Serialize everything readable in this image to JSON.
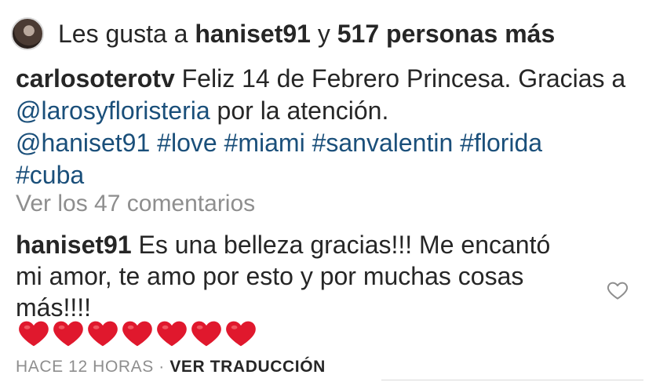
{
  "likes": {
    "prefix": "Les gusta a ",
    "user": "haniset91",
    "conjunction": " y ",
    "others": "517 personas más"
  },
  "caption": {
    "author": "carlosoterotv",
    "text_part1": " Feliz 14 de Febrero Princesa. Gracias a ",
    "mention1": "@larosyfloristeria",
    "text_part2": " por la atención.",
    "mention2": "@haniset91",
    "hashtags": [
      "#love",
      "#miami",
      "#sanvalentin",
      "#florida",
      "#cuba"
    ]
  },
  "view_comments": "Ver los 47 comentarios",
  "comment": {
    "author": "haniset91",
    "text": " Es una belleza gracias!!! Me encantó mi amor, te amo por esto y por muchas cosas más!!!!",
    "emoji": "❤❤❤❤❤❤❤",
    "emoji_count": 7,
    "like_icon": "heart-outline-icon"
  },
  "meta": {
    "timestamp": "HACE 12 HORAS",
    "separator": " · ",
    "translate": "VER TRADUCCIÓN"
  },
  "colors": {
    "text": "#262626",
    "link": "#1a4f7a",
    "muted": "#8e8e8e",
    "heart": "#e0182d"
  }
}
